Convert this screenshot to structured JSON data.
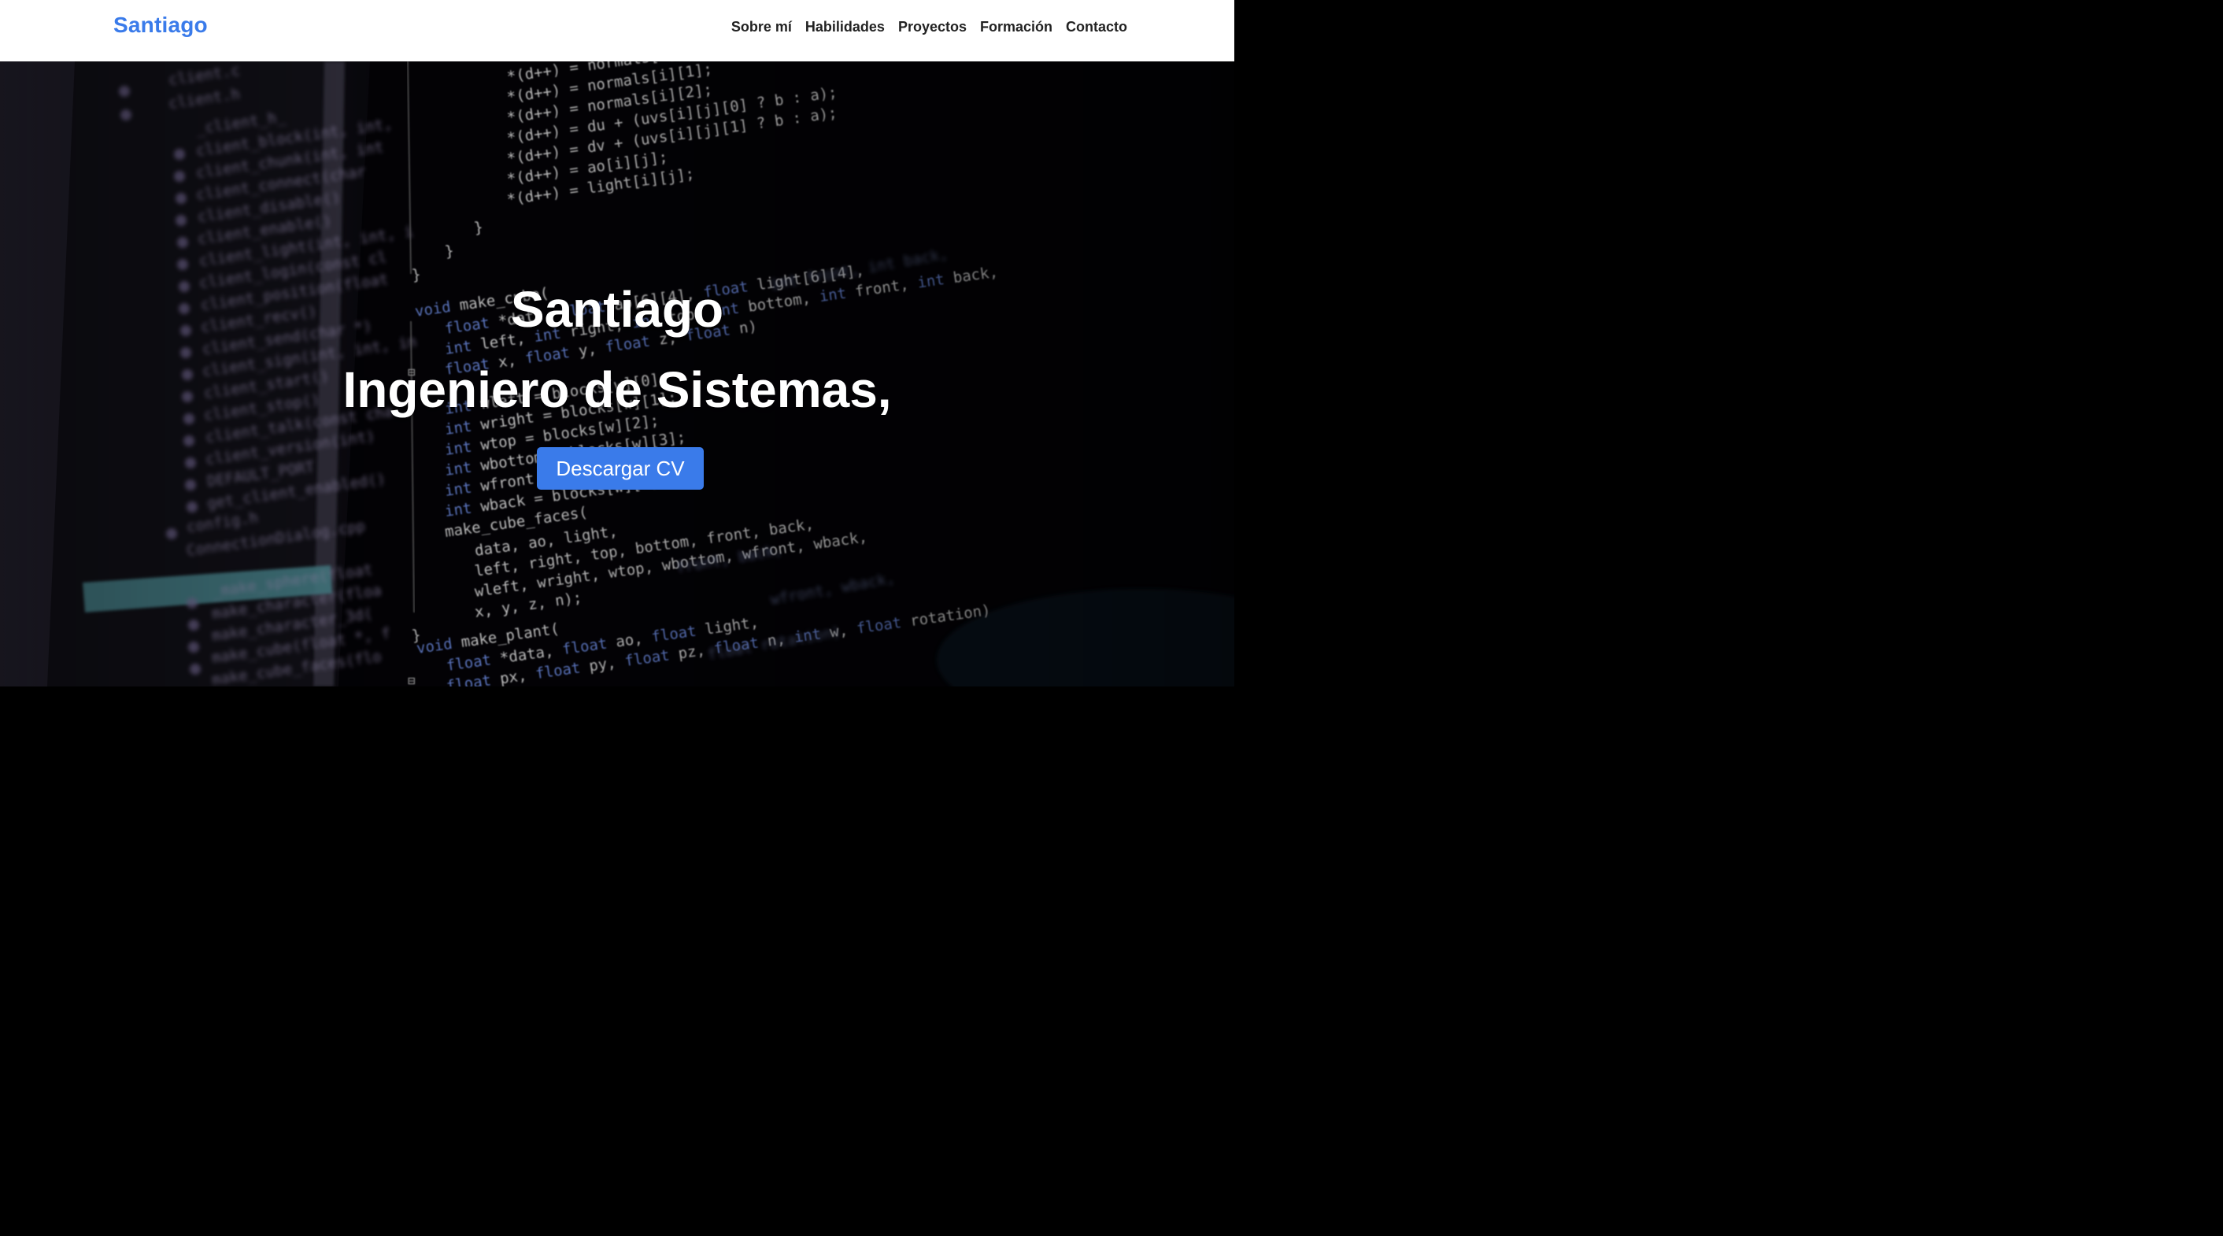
{
  "nav": {
    "brand": "Santiago",
    "links": [
      {
        "label": "Sobre mí"
      },
      {
        "label": "Habilidades"
      },
      {
        "label": "Proyectos"
      },
      {
        "label": "Formación"
      },
      {
        "label": "Contacto"
      }
    ]
  },
  "hero": {
    "name": "Santiago",
    "role": "Ingeniero de Sistemas,",
    "cv_button": "Descargar CV"
  },
  "colors": {
    "accent": "#3a7bea",
    "nav_text": "#222222",
    "hero_bg": "#040307"
  }
}
